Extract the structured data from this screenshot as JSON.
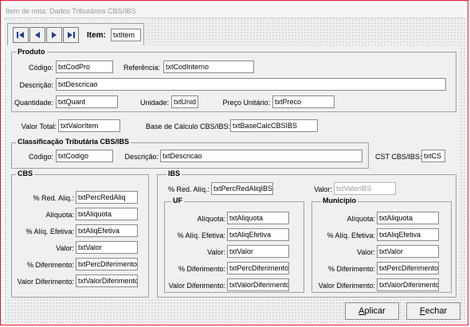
{
  "window": {
    "title": "Item de nota: Dados Tributários CBS/IBS"
  },
  "nav": {
    "item_label": "Item:",
    "item_value": "txtItem",
    "icons": [
      "first-record-icon",
      "previous-record-icon",
      "next-record-icon",
      "last-record-icon"
    ]
  },
  "produto": {
    "legend": "Produto",
    "codigo_label": "Código:",
    "codigo_value": "txtCodPro",
    "referencia_label": "Referência:",
    "referencia_value": "txtCodInterno",
    "descricao_label": "Descrição:",
    "descricao_value": "txtDescricao",
    "quantidade_label": "Quantidade:",
    "quantidade_value": "txtQuant",
    "unidade_label": "Unidade:",
    "unidade_value": "txtUnid",
    "preco_label": "Preço Unitário:",
    "preco_value": "txtPreco"
  },
  "totais": {
    "valor_total_label": "Valor Total:",
    "valor_total_value": "txtValorItem",
    "base_label": "Base de Cálculo CBS/IBS:",
    "base_value": "txtBaseCalcCBSIBS"
  },
  "classificacao": {
    "legend": "Classificação Tributária CBS/IBS",
    "codigo_label": "Código:",
    "codigo_value": "txtCodigo",
    "descricao_label": "Descrição:",
    "descricao_value": "txtDescricao"
  },
  "cst": {
    "label": "CST CBS/IBS:",
    "value": "txtCS"
  },
  "cbs": {
    "legend": "CBS",
    "red_label": "% Red. Aliq.:",
    "red_value": "txtPercRedAliq",
    "aliq_label": "Alíquota:",
    "aliq_value": "txtAliquota",
    "aliqef_label": "% Alíq. Efetiva:",
    "aliqef_value": "txtAliqEfetiva",
    "valor_label": "Valor:",
    "valor_value": "txtValor",
    "dif_label": "% Diferimento:",
    "dif_value": "txtPercDiferimento",
    "valdif_label": "Valor Diferimento:",
    "valdif_value": "txtValorDiferimentc"
  },
  "ibs": {
    "legend": "IBS",
    "red_label": "% Red. Alíq.:",
    "red_value": "txtPercRedAliqIBS",
    "valor_label": "Valor:",
    "valor_value": "txtValorIBS",
    "uf": {
      "legend": "UF",
      "aliq_label": "Alíquota:",
      "aliq_value": "txtAliquota",
      "aliqef_label": "% Alíq. Efetiva:",
      "aliqef_value": "txtAliqEfetiva",
      "valor_label": "Valor:",
      "valor_value": "txtValor",
      "dif_label": "% Diferimento:",
      "dif_value": "txtPercDiferimento",
      "valdif_label": "Valor Diferimento:",
      "valdif_value": "txtValorDiferimentc"
    },
    "municipio": {
      "legend": "Município",
      "aliq_label": "Alíquota:",
      "aliq_value": "txtAliquota",
      "aliqef_label": "% Alíq. Efetiva:",
      "aliqef_value": "txtAliqEfetiva",
      "valor_label": "Valor:",
      "valor_value": "txtValor",
      "dif_label": "% Diferimento:",
      "dif_value": "txtPercDiferimento",
      "valdif_label": "Valor Diferimento:",
      "valdif_value": "txtValorDiferimentc"
    }
  },
  "buttons": {
    "aplicar_hotkey": "A",
    "aplicar_rest": "plicar",
    "fechar_hotkey": "F",
    "fechar_rest": "echar"
  },
  "colors": {
    "form_bg": "#f0f0f0",
    "frame_border": "#e81123",
    "disabled_text": "#9a9a9a"
  }
}
